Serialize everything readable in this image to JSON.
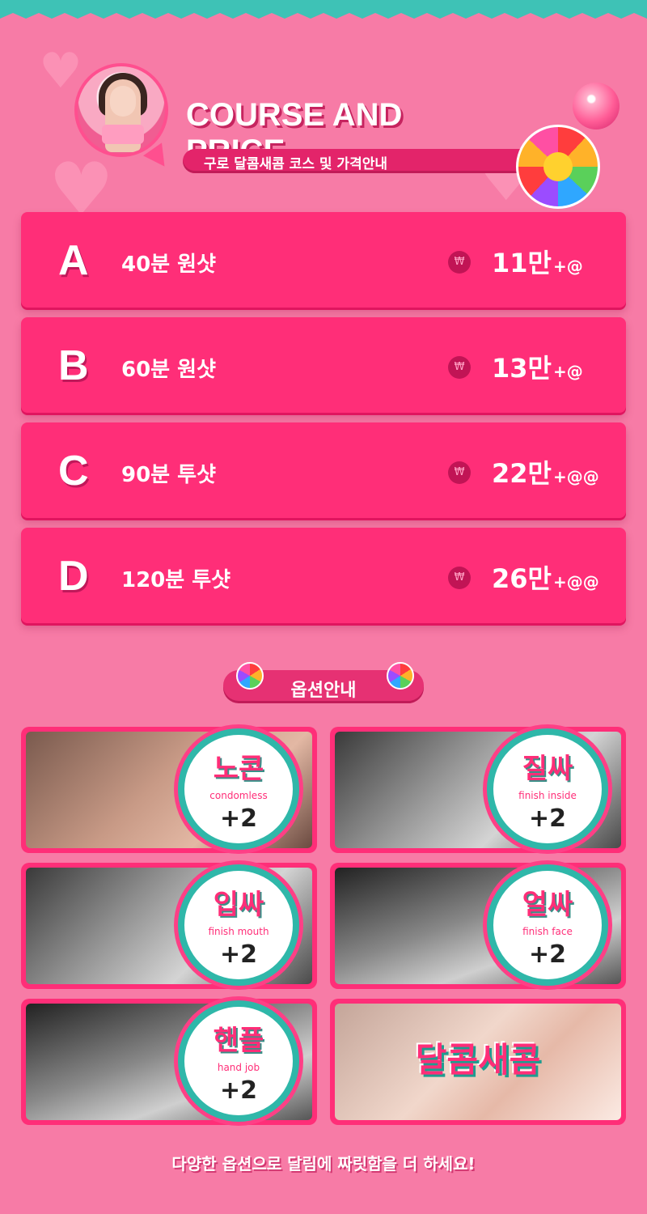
{
  "header": {
    "title": "COURSE AND PRICE",
    "subtitle": "구로 달콤새콤 코스 및 가격안내"
  },
  "courses": [
    {
      "letter": "A",
      "desc": "40분  원샷",
      "currency": "₩",
      "price": "11만",
      "extra": "+@"
    },
    {
      "letter": "B",
      "desc": "60분  원샷",
      "currency": "₩",
      "price": "13만",
      "extra": "+@"
    },
    {
      "letter": "C",
      "desc": "90분  투샷",
      "currency": "₩",
      "price": "22만",
      "extra": "+@@"
    },
    {
      "letter": "D",
      "desc": "120분  투샷",
      "currency": "₩",
      "price": "26만",
      "extra": "+@@"
    }
  ],
  "options_heading": "옵션안내",
  "options": [
    {
      "ko": "노콘",
      "en": "condomless",
      "price": "+2"
    },
    {
      "ko": "질싸",
      "en": "finish inside",
      "price": "+2"
    },
    {
      "ko": "입싸",
      "en": "finish mouth",
      "price": "+2"
    },
    {
      "ko": "얼싸",
      "en": "finish face",
      "price": "+2"
    },
    {
      "ko": "핸플",
      "en": "hand job",
      "price": "+2"
    }
  ],
  "promo_text": "달콤새콤",
  "footer": "다양한 옵션으로 달림에 짜릿함을 더 하세요!",
  "colors": {
    "background": "#f77ba6",
    "card": "#ff2e78",
    "teal": "#2fb7a9"
  }
}
